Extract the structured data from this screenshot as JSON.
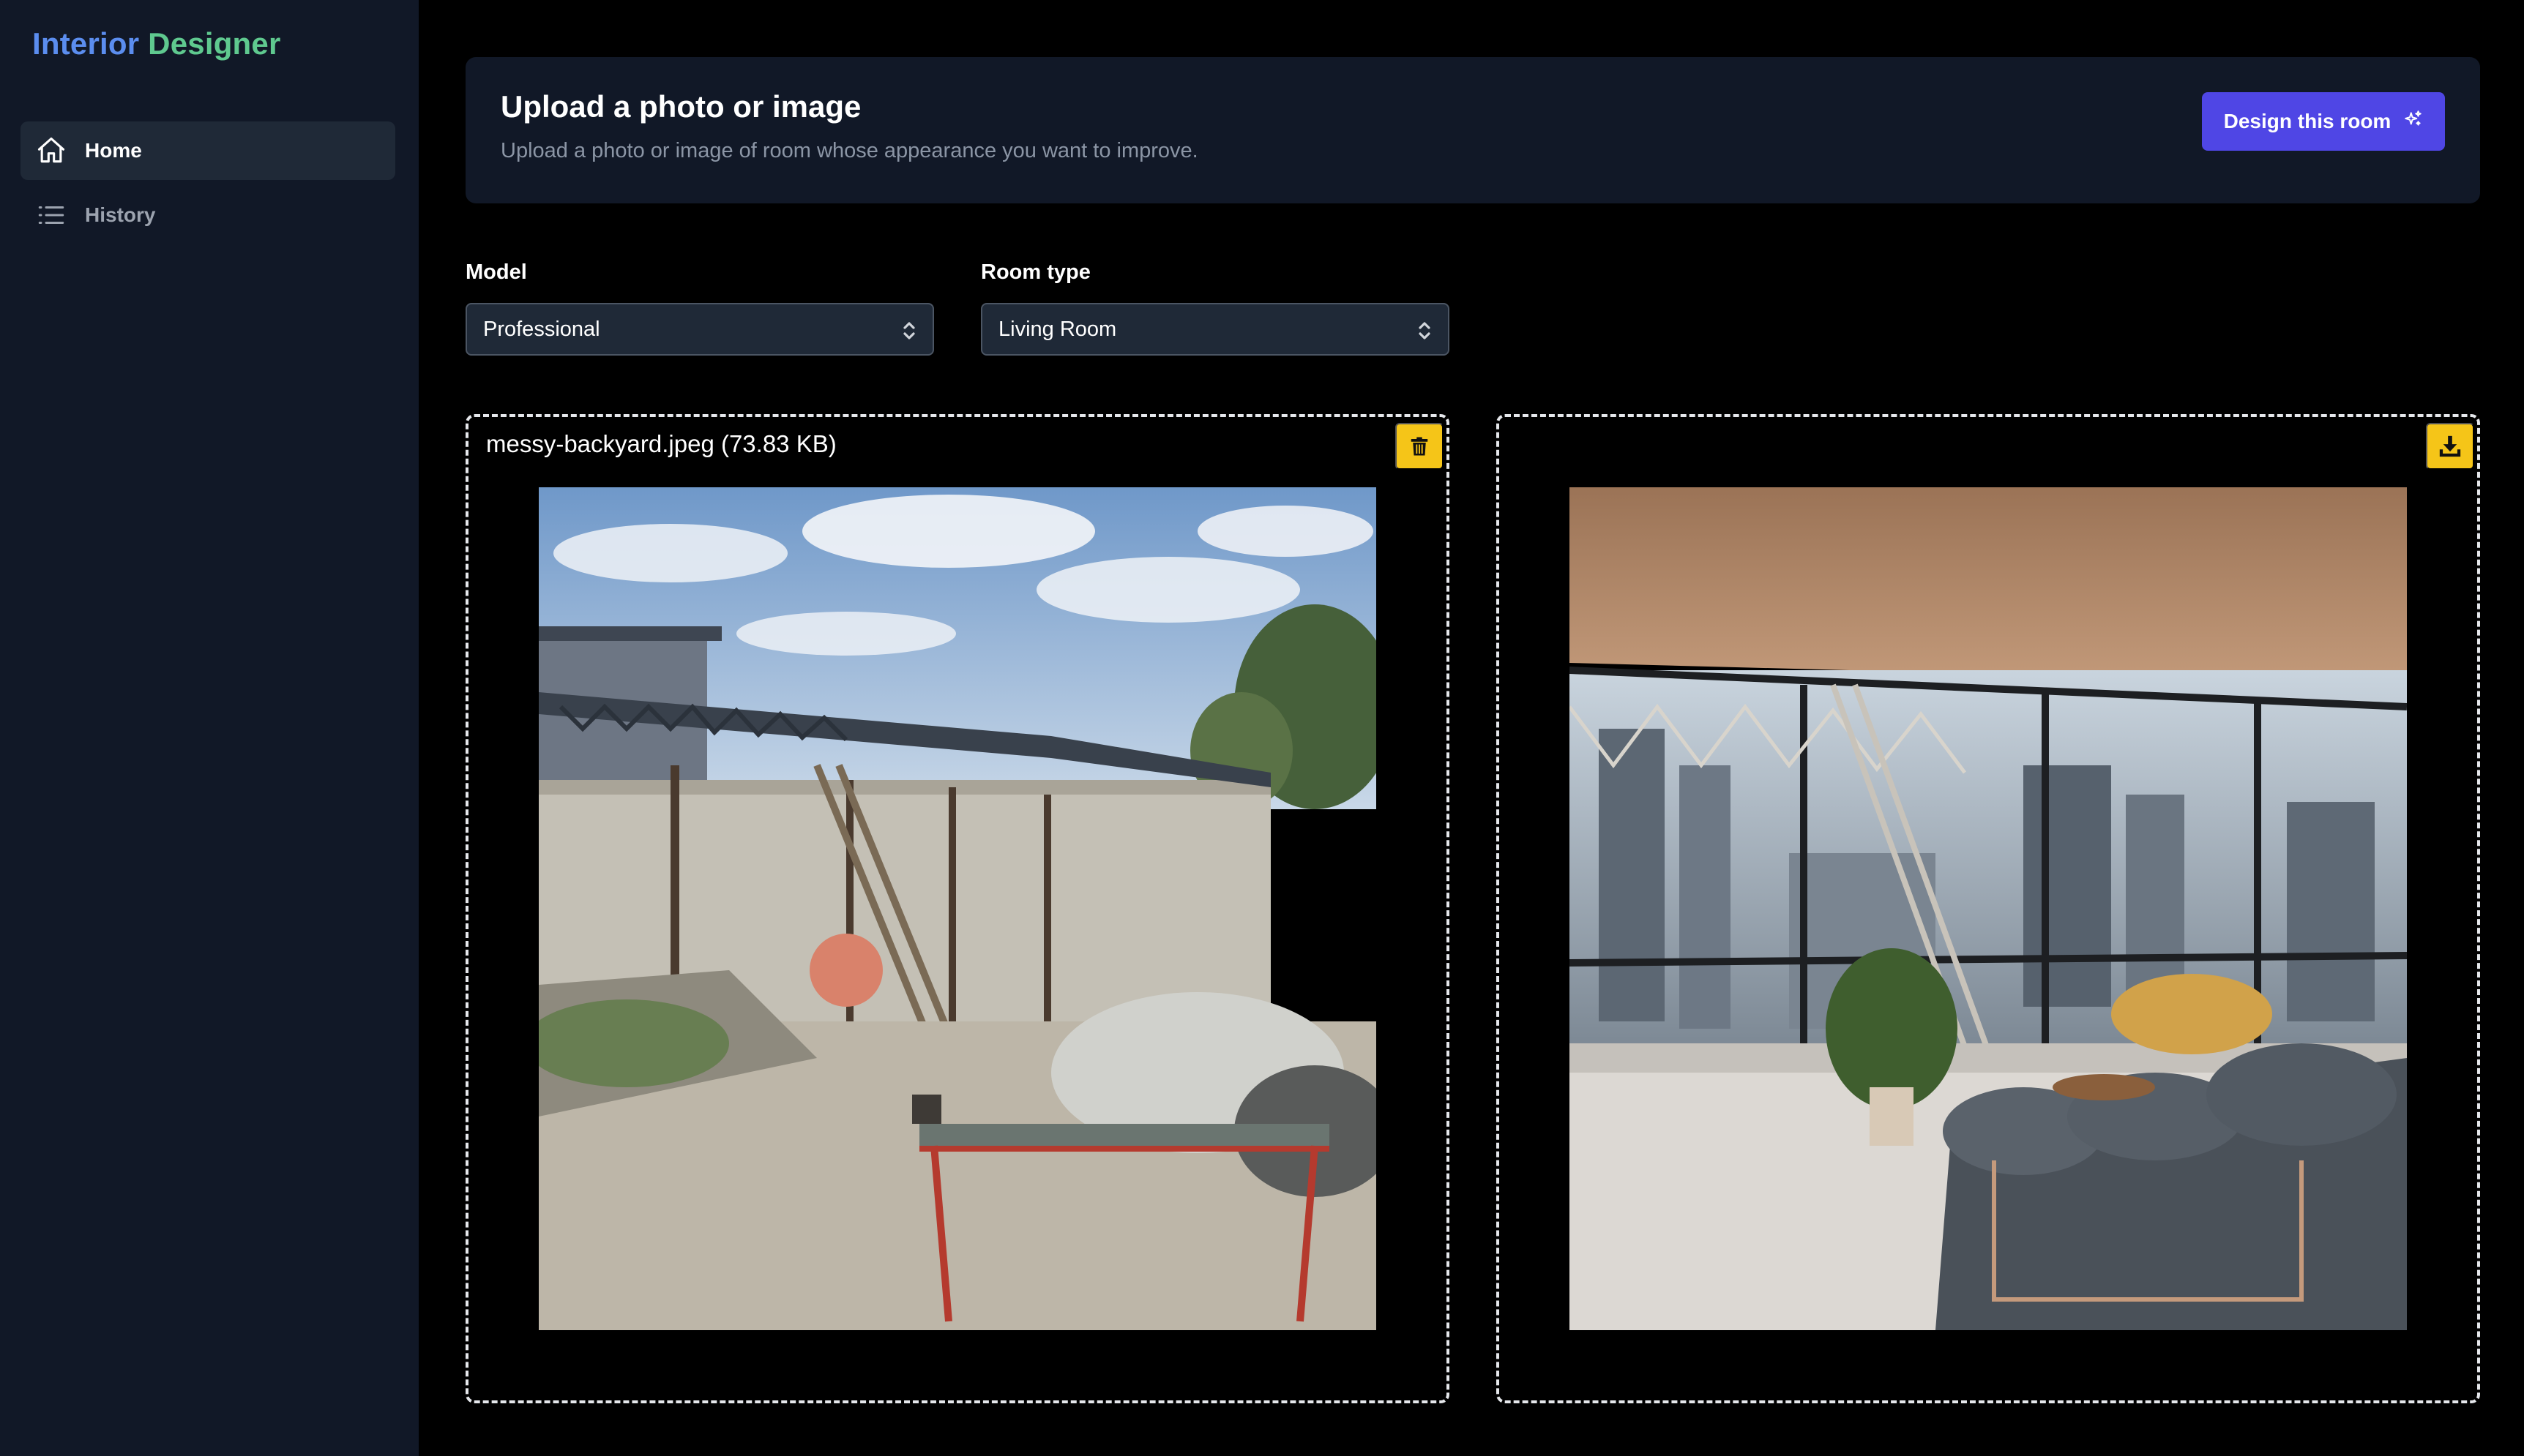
{
  "app": {
    "title_part1": "Interior",
    "title_part2": "Designer"
  },
  "sidebar": {
    "items": [
      {
        "label": "Home",
        "icon": "home-icon",
        "active": true
      },
      {
        "label": "History",
        "icon": "list-icon",
        "active": false
      }
    ]
  },
  "upload": {
    "title": "Upload a photo or image",
    "subtitle": "Upload a photo or image of room whose appearance you want to improve.",
    "design_button": "Design this room"
  },
  "form": {
    "model": {
      "label": "Model",
      "value": "Professional"
    },
    "room_type": {
      "label": "Room type",
      "value": "Living Room"
    }
  },
  "input_image": {
    "file_name": "messy-backyard.jpeg (73.83 KB)",
    "action_icon": "trash-icon"
  },
  "output_image": {
    "action_icon": "download-icon"
  },
  "colors": {
    "accent": "#4f46e5",
    "sidebar_bg": "#111827",
    "action_yellow": "#f5c518"
  }
}
